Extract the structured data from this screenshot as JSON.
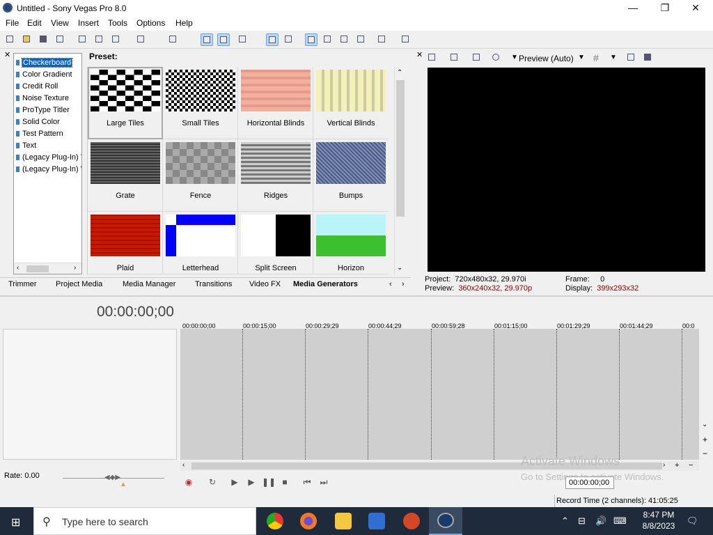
{
  "window": {
    "title": "Untitled - Sony Vegas Pro 8.0"
  },
  "menu": [
    "File",
    "Edit",
    "View",
    "Insert",
    "Tools",
    "Options",
    "Help"
  ],
  "generators": {
    "items": [
      "Checkerboard",
      "Color Gradient",
      "Credit Roll",
      "Noise Texture",
      "ProType Titler",
      "Solid Color",
      "Test Pattern",
      "Text",
      "(Legacy Plug-In) T",
      "(Legacy Plug-In) V"
    ],
    "selected": "Checkerboard"
  },
  "presets": {
    "label": "Preset:",
    "items": [
      "Large Tiles",
      "Small Tiles",
      "Horizontal Blinds",
      "Vertical Blinds",
      "Grate",
      "Fence",
      "Ridges",
      "Bumps",
      "Plaid",
      "Letterhead",
      "Split Screen",
      "Horizon"
    ],
    "selected": "Large Tiles"
  },
  "tabs": {
    "items": [
      "Trimmer",
      "Project Media",
      "Media Manager",
      "Transitions",
      "Video FX",
      "Media Generators"
    ],
    "active": "Media Generators"
  },
  "preview": {
    "mode": "Preview (Auto)",
    "project_label": "Project:",
    "project_value": "720x480x32, 29.970i",
    "preview_label": "Preview:",
    "preview_value": "360x240x32, 29.970p",
    "frame_label": "Frame:",
    "frame_value": "0",
    "display_label": "Display:",
    "display_value": "399x293x32"
  },
  "timeline": {
    "timecode": "00:00:00;00",
    "ticks": [
      "00:00:00;00",
      "00:00:15;00",
      "00:00:29;29",
      "00:00:44;29",
      "00:00:59;28",
      "00:01:15;00",
      "00:01:29;29",
      "00:01:44;29",
      "00:0"
    ],
    "rate": "Rate: 0.00",
    "transport_time": "00:00:00;00",
    "record_time": "Record Time (2 channels): 41:05:25"
  },
  "watermark": {
    "line1": "Activate Windows",
    "line2": "Go to Settings to activate Windows."
  },
  "taskbar": {
    "search_placeholder": "Type here to search",
    "time": "8:47 PM",
    "date": "8/8/2023"
  }
}
